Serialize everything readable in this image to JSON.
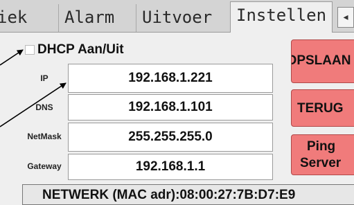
{
  "tabs": [
    {
      "label": "iek"
    },
    {
      "label": "Alarm"
    },
    {
      "label": "Uitvoer"
    },
    {
      "label": "Instellen"
    }
  ],
  "tab_scroll_icon": "◂",
  "dhcp": {
    "label": "DHCP Aan/Uit",
    "checked": false
  },
  "network": {
    "ip": {
      "label": "IP",
      "value": "192.168.1.221"
    },
    "dns": {
      "label": "DNS",
      "value": "192.168.1.101"
    },
    "netmask": {
      "label": "NetMask",
      "value": "255.255.255.0"
    },
    "gateway": {
      "label": "Gateway",
      "value": "192.168.1.1"
    }
  },
  "buttons": {
    "save": "OPSLAAN",
    "back": "TERUG",
    "ping_line1": "Ping",
    "ping_line2": "Server"
  },
  "status": "NETWERK (MAC adr):08:00:27:7B:D7:E9",
  "colors": {
    "button_red": "#f07b7b",
    "arrow": "#000000"
  }
}
